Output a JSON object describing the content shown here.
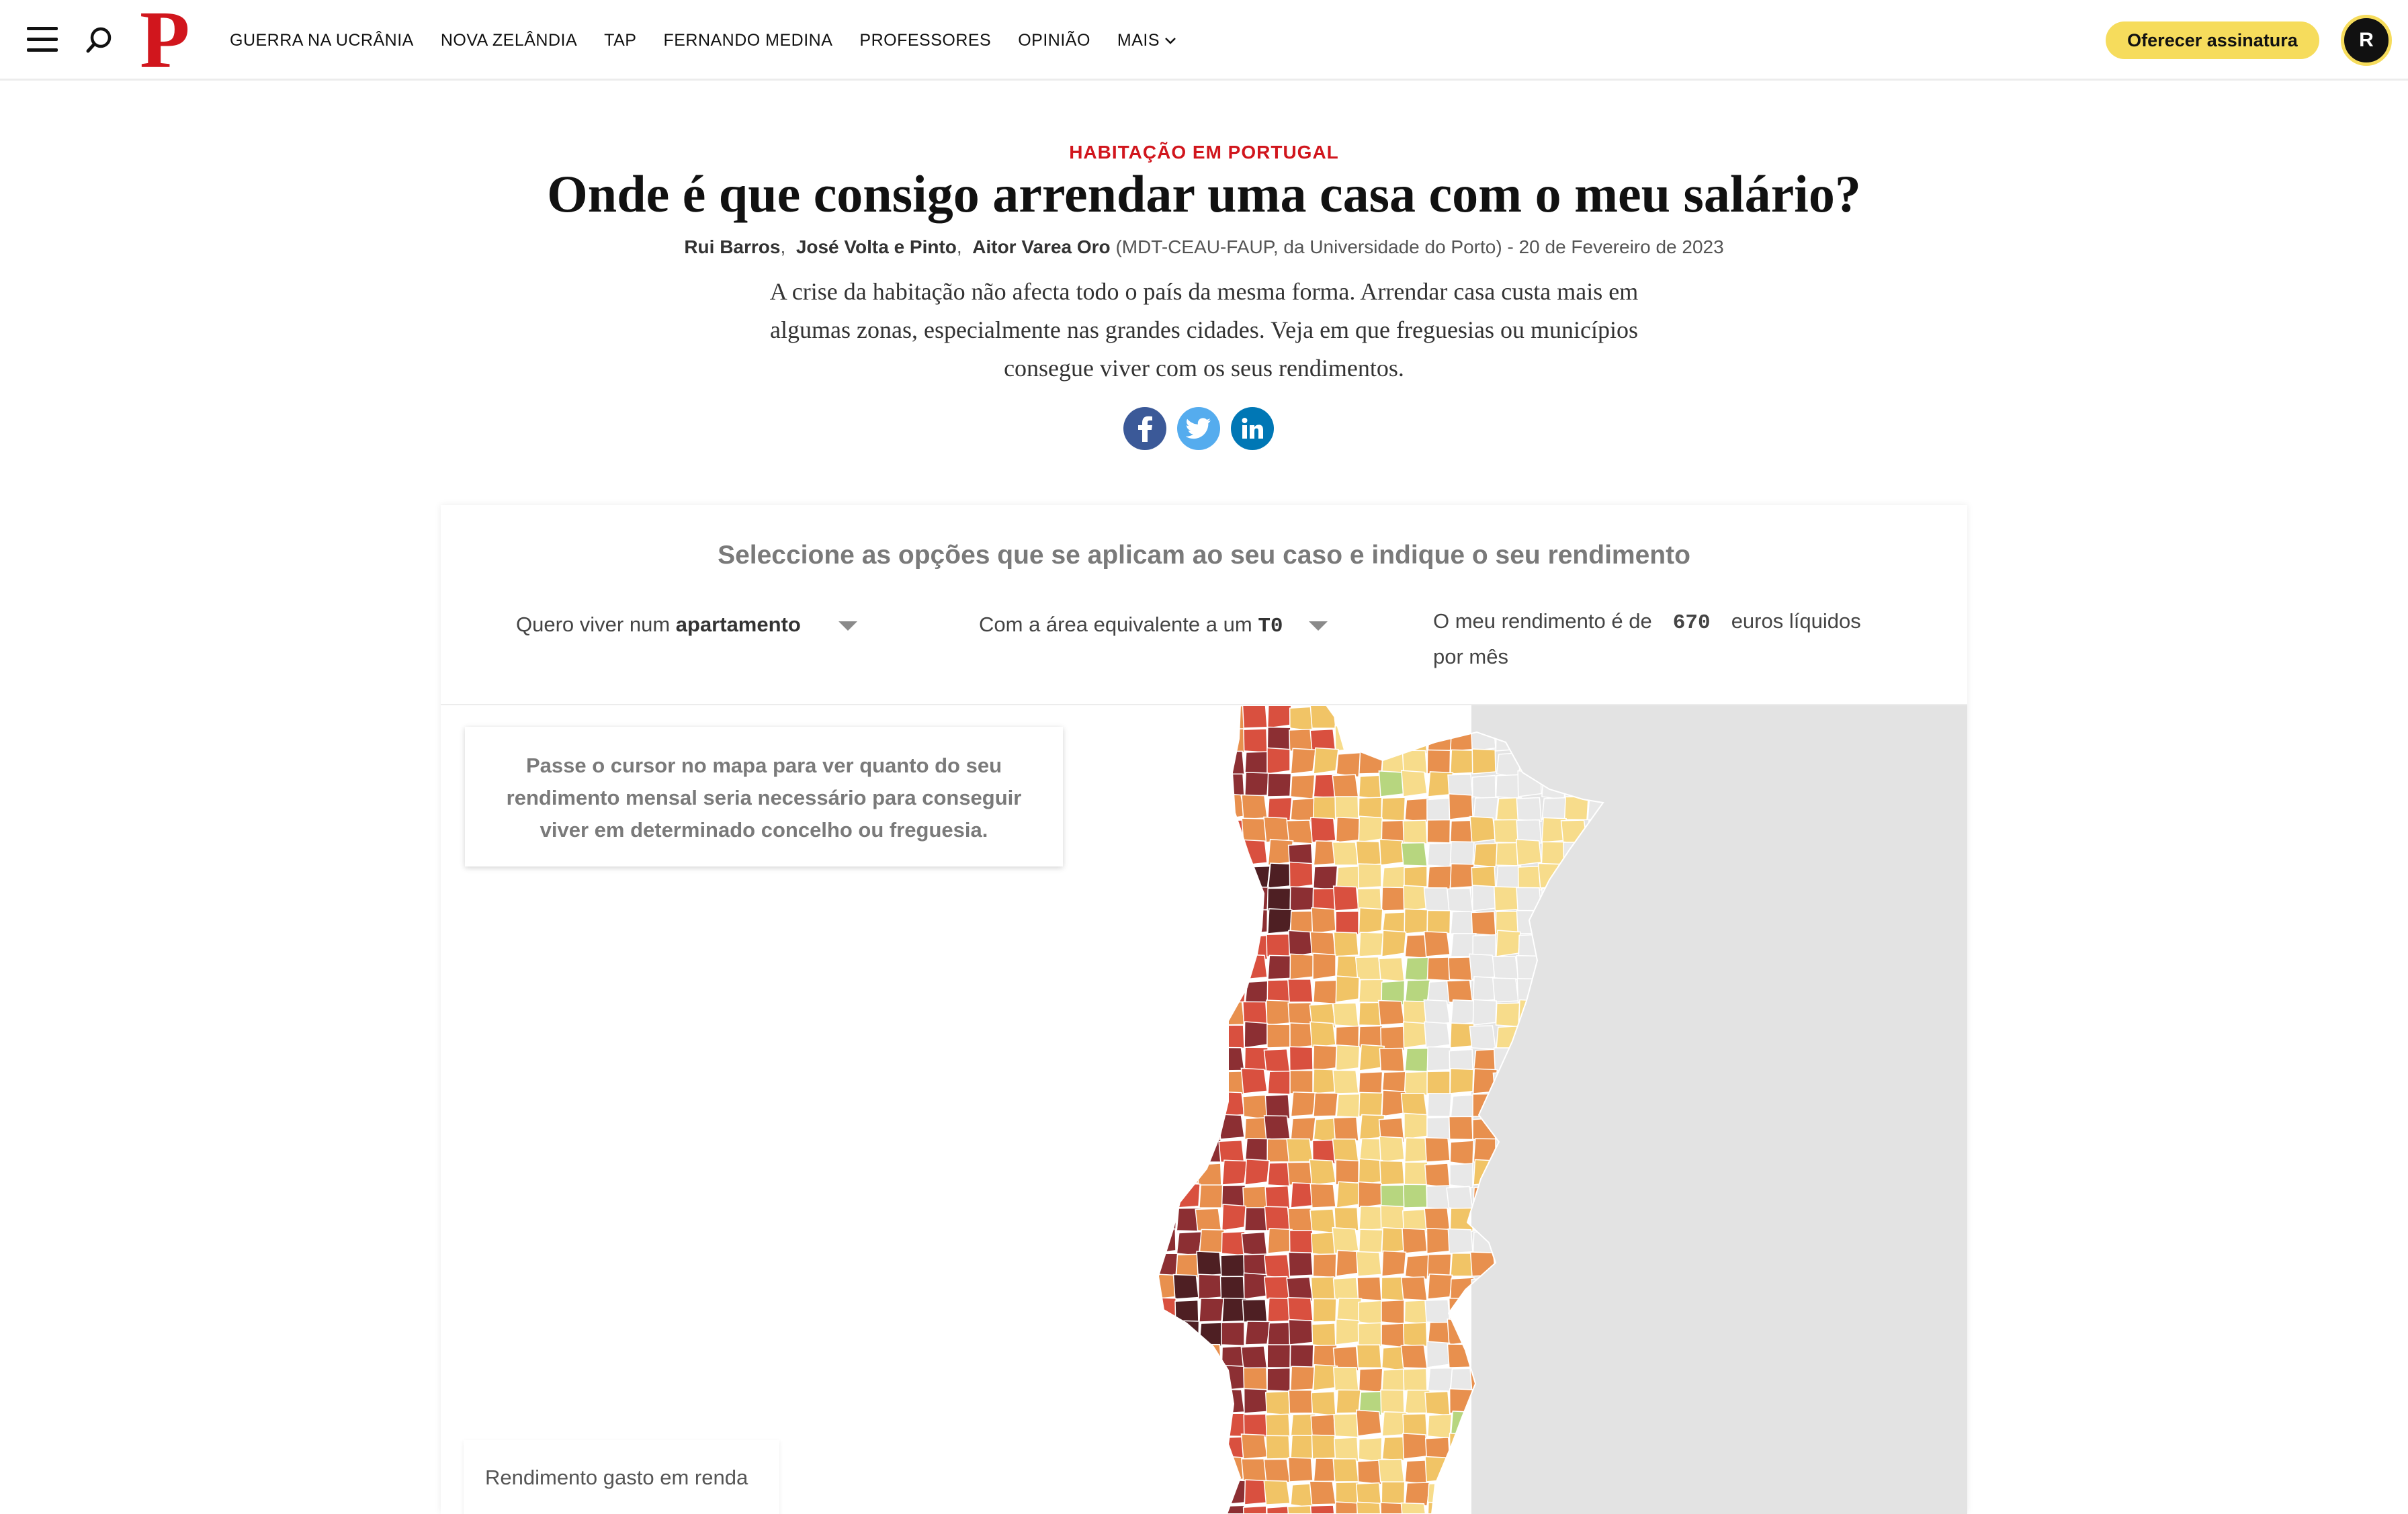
{
  "nav": {
    "menu_icon": "hamburger-menu-icon",
    "search_icon": "search-icon",
    "logo_text": "P",
    "links": [
      "GUERRA NA UCRÂNIA",
      "NOVA ZELÂNDIA",
      "TAP",
      "FERNANDO MEDINA",
      "PROFESSORES",
      "OPINIÃO"
    ],
    "more_label": "MAIS",
    "subscribe_label": "Oferecer assinatura",
    "avatar_initial": "R"
  },
  "article": {
    "kicker": "HABITAÇÃO EM PORTUGAL",
    "headline": "Onde é que consigo arrendar uma casa com o meu salário?",
    "authors": [
      "Rui Barros",
      "José Volta e Pinto",
      "Aitor Varea Oro"
    ],
    "affiliation": "(MDT-CEAU-FAUP, da Universidade do Porto)",
    "date": "- 20 de Fevereiro de 2023",
    "lead": "A crise da habitação não afecta todo o país da mesma forma. Arrendar casa custa mais em algumas zonas, especialmente nas grandes cidades. Veja em que freguesias ou municípios consegue viver com os seus rendimentos.",
    "share": [
      "facebook-icon",
      "twitter-icon",
      "linkedin-icon"
    ]
  },
  "tool": {
    "title": "Seleccione as opções que se aplicam ao seu caso e indique o seu rendimento",
    "housing_prefix": "Quero viver num",
    "housing_value": "apartamento",
    "area_prefix": "Com a área equivalente a um",
    "area_value": "T0",
    "income_prefix": "O meu rendimento é de",
    "income_value": "670",
    "income_suffix": "euros líquidos",
    "income_suffix2": "por mês",
    "hint": "Passe o cursor no mapa para ver quanto do seu rendimento mensal seria necessário para conseguir viver em determinado concelho ou freguesia.",
    "legend_title": "Rendimento gasto em renda"
  },
  "map_colors": {
    "spain": "#e3e3e3",
    "no_data": "#e8e8e8",
    "green": "#b7d67f",
    "light_yellow": "#f7dc8b",
    "yellow": "#f1c466",
    "orange": "#e8904e",
    "red": "#d9503f",
    "dark_red": "#8c2f33",
    "darkest": "#4e1f23"
  }
}
